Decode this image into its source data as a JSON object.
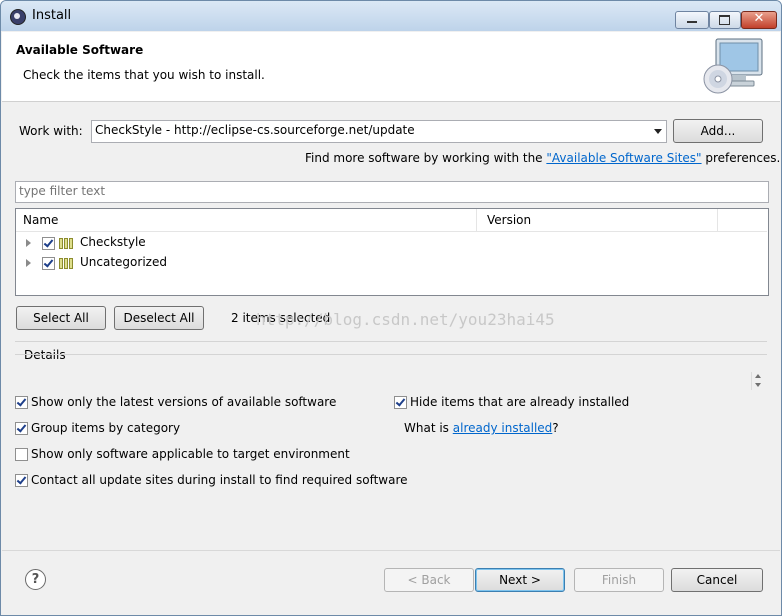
{
  "window": {
    "title": "Install"
  },
  "header": {
    "title": "Available Software",
    "description": "Check the items that you wish to install."
  },
  "work_with": {
    "label": "Work with:",
    "value": "CheckStyle - http://eclipse-cs.sourceforge.net/update",
    "add_button": "Add...",
    "more_prefix": "Find more software by working with the ",
    "more_link": "\"Available Software Sites\"",
    "more_suffix": " preferences."
  },
  "filter": {
    "placeholder": "type filter text"
  },
  "tree": {
    "columns": [
      "Name",
      "Version"
    ],
    "rows": [
      {
        "name": "Checkstyle",
        "version": "",
        "checked": true
      },
      {
        "name": "Uncategorized",
        "version": "",
        "checked": true
      }
    ]
  },
  "selection": {
    "select_all": "Select All",
    "deselect_all": "Deselect All",
    "status": "2 items selected"
  },
  "watermark": "http://blog.csdn.net/you23hai45",
  "details": {
    "label": "Details"
  },
  "options": {
    "latest_only": {
      "label": "Show only the latest versions of available software",
      "checked": true
    },
    "group_by_category": {
      "label": "Group items by category",
      "checked": true
    },
    "target_env_only": {
      "label": "Show only software applicable to target environment",
      "checked": false
    },
    "contact_sites": {
      "label": "Contact all update sites during install to find required software",
      "checked": true
    },
    "hide_installed": {
      "label": "Hide items that are already installed",
      "checked": true
    },
    "what_is_prefix": "What is ",
    "what_is_link": "already installed",
    "what_is_suffix": "?"
  },
  "buttons": {
    "help": "?",
    "back": "< Back",
    "next": "Next >",
    "finish": "Finish",
    "cancel": "Cancel"
  },
  "colors": {
    "link": "#0066cc",
    "title_bar": "#c9dbee",
    "close_button": "#c2402a"
  }
}
